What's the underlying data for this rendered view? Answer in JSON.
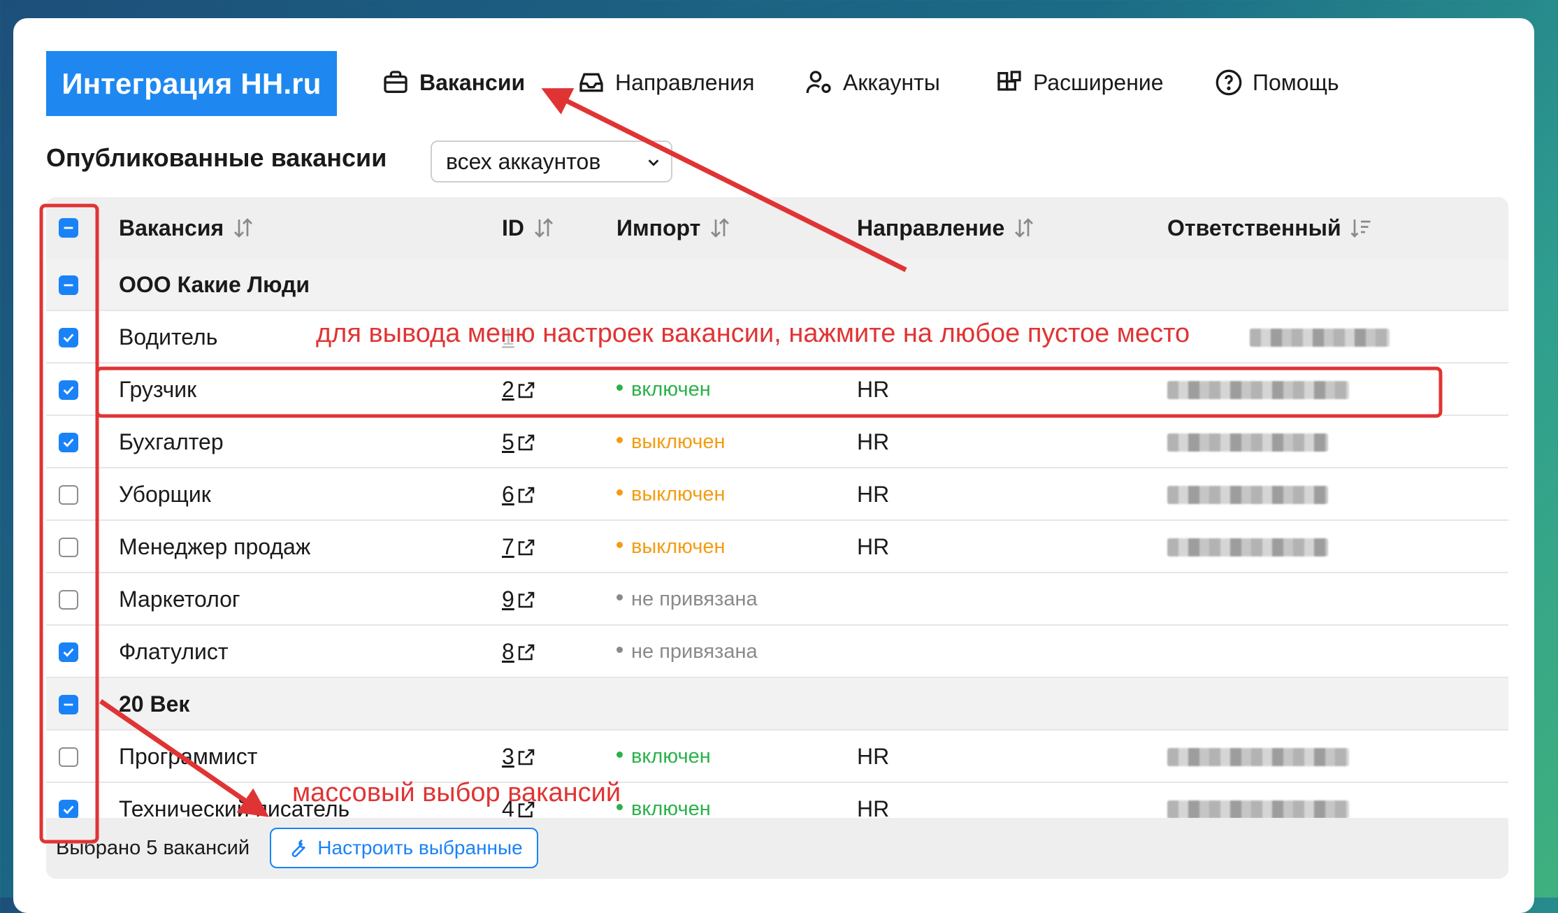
{
  "header": {
    "brand": "Интеграция HH.ru",
    "nav": [
      {
        "label": "Вакансии",
        "icon": "briefcase-icon",
        "active": true
      },
      {
        "label": "Направления",
        "icon": "inbox-icon"
      },
      {
        "label": "Аккаунты",
        "icon": "user-settings-icon"
      },
      {
        "label": "Расширение",
        "icon": "puzzle-icon"
      },
      {
        "label": "Помощь",
        "icon": "help-circle-icon"
      }
    ]
  },
  "page": {
    "title": "Опубликованные вакансии",
    "account_filter": "всех аккаунтов"
  },
  "table": {
    "columns": {
      "vacancy": "Вакансия",
      "id": "ID",
      "import": "Импорт",
      "direction": "Направление",
      "responsible": "Ответственный"
    },
    "group1": "ООО Какие Люди",
    "group2": "20 Век",
    "rows": [
      {
        "name": "Водитель",
        "id": "1",
        "status": "",
        "direction": "",
        "checked": true
      },
      {
        "name": "Грузчик",
        "id": "2",
        "status": "включен",
        "direction": "HR",
        "checked": true
      },
      {
        "name": "Бухгалтер",
        "id": "5",
        "status": "выключен",
        "direction": "HR",
        "checked": true
      },
      {
        "name": "Уборщик",
        "id": "6",
        "status": "выключен",
        "direction": "HR",
        "checked": false
      },
      {
        "name": "Менеджер продаж",
        "id": "7",
        "status": "выключен",
        "direction": "HR",
        "checked": false
      },
      {
        "name": "Маркетолог",
        "id": "9",
        "status": "не привязана",
        "direction": "",
        "checked": false
      },
      {
        "name": "Флатулист",
        "id": "8",
        "status": "не привязана",
        "direction": "",
        "checked": true
      },
      {
        "name": "Программист",
        "id": "3",
        "status": "включен",
        "direction": "HR",
        "checked": false
      },
      {
        "name": "Технический писатель",
        "id": "4",
        "status": "включен",
        "direction": "HR",
        "checked": true
      }
    ]
  },
  "footer": {
    "selected_text": "Выбрано 5 вакансий",
    "configure_button": "Настроить выбранные"
  },
  "annotations": {
    "settings_hint": "для вывода меню настроек вакансии, нажмите на любое пустое место",
    "bulk_hint": "массовый выбор вакансий"
  },
  "colors": {
    "accent": "#1e88f0",
    "enabled": "#2ab24a",
    "disabled": "#f39c12",
    "unlinked": "#8a8a8a",
    "annotation": "#e03434"
  }
}
